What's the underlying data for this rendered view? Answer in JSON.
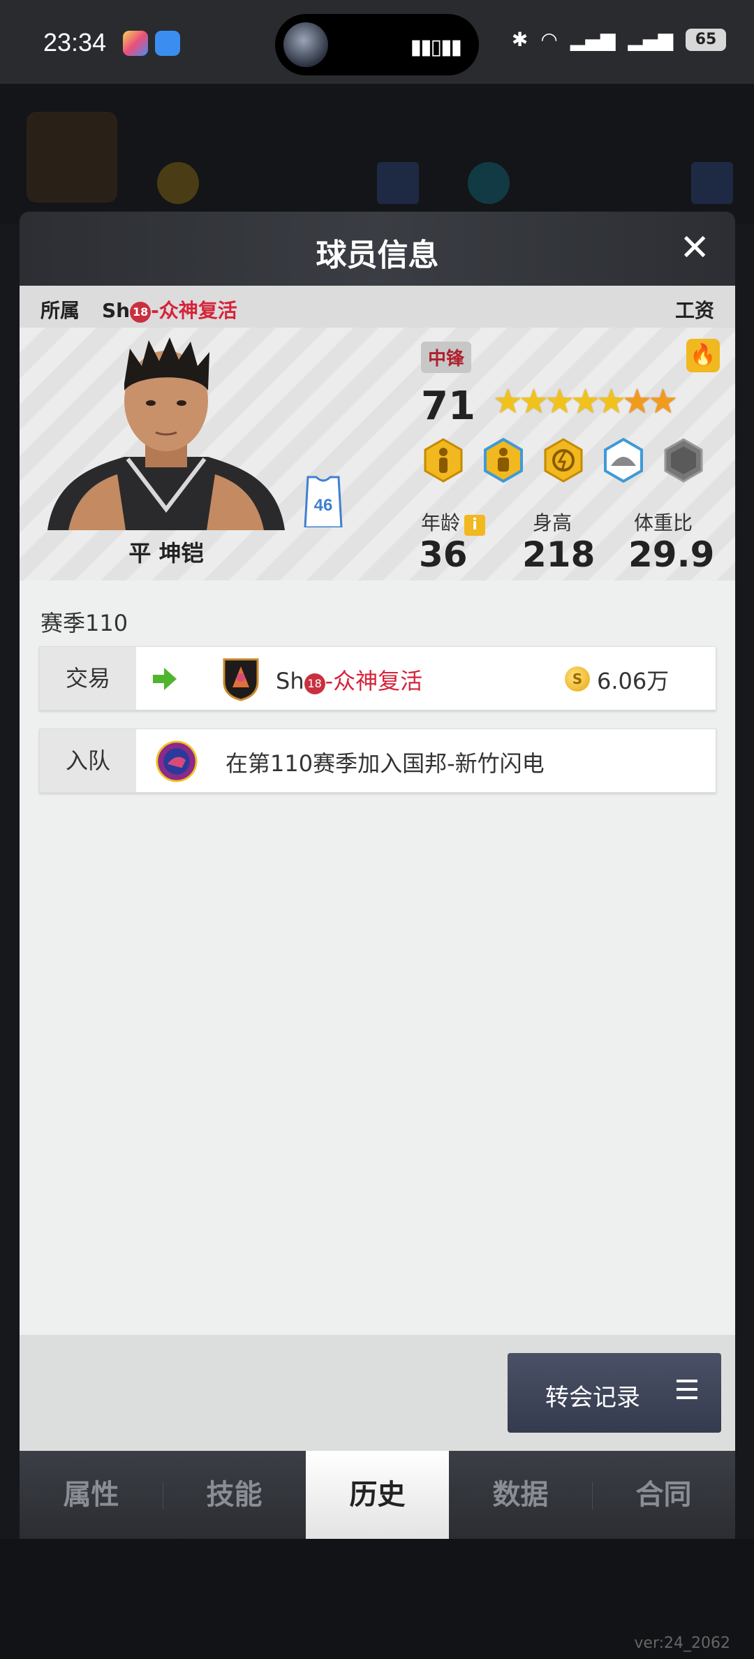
{
  "status_bar": {
    "time": "23:34",
    "battery": "65",
    "icons": [
      "bluetooth-icon",
      "wifi-icon",
      "signal-5g-icon",
      "signal-5g-icon"
    ]
  },
  "modal": {
    "title": "球员信息",
    "affiliation_label": "所属",
    "team_prefix": "Sh",
    "team_badge": "18",
    "team_name": "-众神复活",
    "salary_label": "工资"
  },
  "player": {
    "name": "平 坤铠",
    "jersey_number": "46",
    "position": "中锋",
    "overall": "71",
    "stars_total": 7,
    "stars_gold": 5,
    "age_label": "年龄",
    "age": "36",
    "height_label": "身高",
    "height": "218",
    "weight_ratio_label": "体重比",
    "weight_ratio": "29.9"
  },
  "history": {
    "season_title": "赛季110",
    "events": [
      {
        "type": "交易",
        "team_prefix": "Sh",
        "team_badge": "18",
        "team_name": "-众神复活",
        "amount": "6.06万"
      },
      {
        "type": "入队",
        "text": "在第110赛季加入国邦-新竹闪电"
      }
    ]
  },
  "buttons": {
    "transfer_record": "转会记录"
  },
  "tabs": [
    "属性",
    "技能",
    "历史",
    "数据",
    "合同"
  ],
  "active_tab": "历史",
  "version": "ver:24_2062",
  "colors": {
    "accent_red": "#d6223a",
    "gold": "#f1b81f",
    "dark_header": "#2c2e33"
  }
}
